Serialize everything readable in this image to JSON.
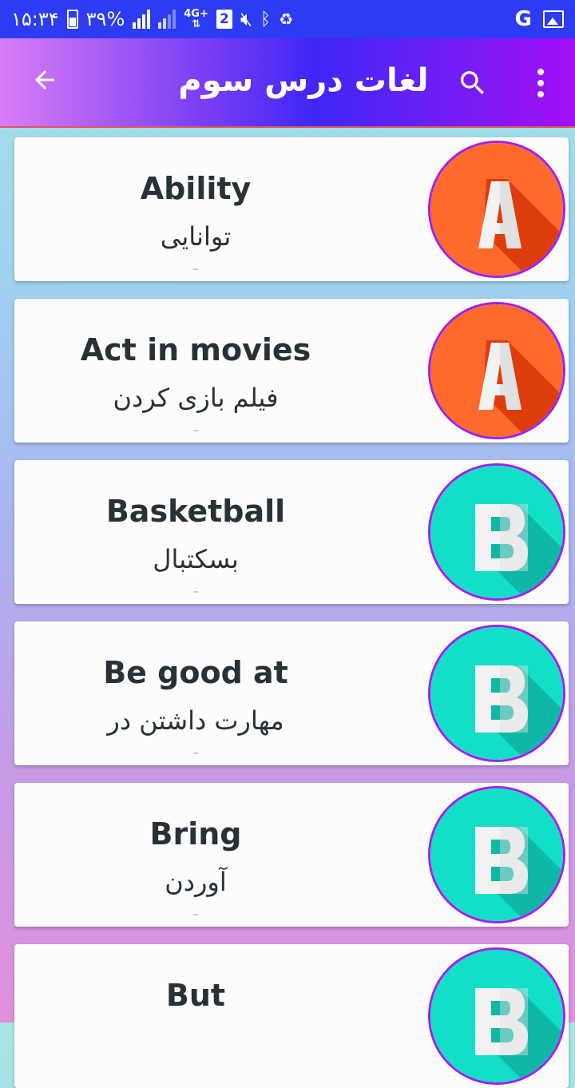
{
  "status_bar": {
    "time": "۱۵:۳۴",
    "battery": "۳۹%",
    "network": "4G+",
    "sim": "2",
    "right_letter": "G"
  },
  "app_bar": {
    "title": "لغات درس سوم",
    "back_icon": "arrow-back-icon",
    "search_icon": "search-icon",
    "menu_icon": "more-vert-icon"
  },
  "colors": {
    "orange_avatar": "#fd6a2c",
    "teal_avatar": "#13dfc9",
    "avatar_border": "#a020f0",
    "text": "#263238"
  },
  "items": [
    {
      "word": "Ability",
      "meaning": "توانایی",
      "letter": "A",
      "color": "orange"
    },
    {
      "word": "Act in movies",
      "meaning": "فیلم بازی کردن",
      "letter": "A",
      "color": "orange"
    },
    {
      "word": "Basketball",
      "meaning": "بسکتبال",
      "letter": "B",
      "color": "teal"
    },
    {
      "word": "Be good at",
      "meaning": "مهارت داشتن در",
      "letter": "B",
      "color": "teal"
    },
    {
      "word": "Bring",
      "meaning": "آوردن",
      "letter": "B",
      "color": "teal"
    },
    {
      "word": "But",
      "meaning": "",
      "letter": "B",
      "color": "teal"
    }
  ]
}
